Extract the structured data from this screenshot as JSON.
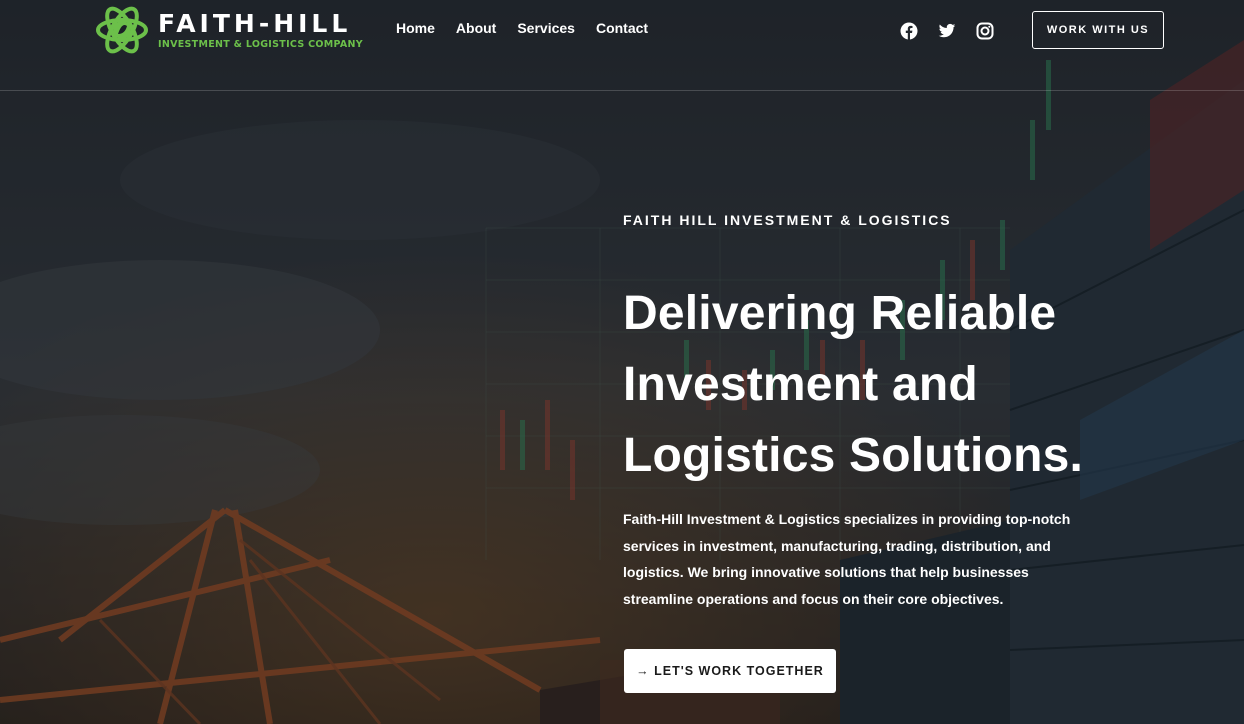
{
  "brand": {
    "name": "FAITH-HILL",
    "tagline": "INVESTMENT & LOGISTICS COMPANY",
    "accent_color": "#6cc04a"
  },
  "nav": {
    "items": [
      {
        "label": "Home"
      },
      {
        "label": "About"
      },
      {
        "label": "Services"
      },
      {
        "label": "Contact"
      }
    ]
  },
  "social": {
    "icons": [
      "facebook-icon",
      "twitter-icon",
      "instagram-icon"
    ]
  },
  "header_cta": {
    "label": "WORK WITH US"
  },
  "hero": {
    "eyebrow": "FAITH HILL INVESTMENT & LOGISTICS",
    "headline": "Delivering Reliable Investment and Logistics Solutions.",
    "description": "Faith-Hill Investment & Logistics specializes in providing top-notch services in investment, manufacturing, trading, distribution, and logistics. We bring innovative solutions that help businesses streamline operations and focus on their core objectives.",
    "cta_label": "→ LET'S WORK TOGETHER"
  }
}
